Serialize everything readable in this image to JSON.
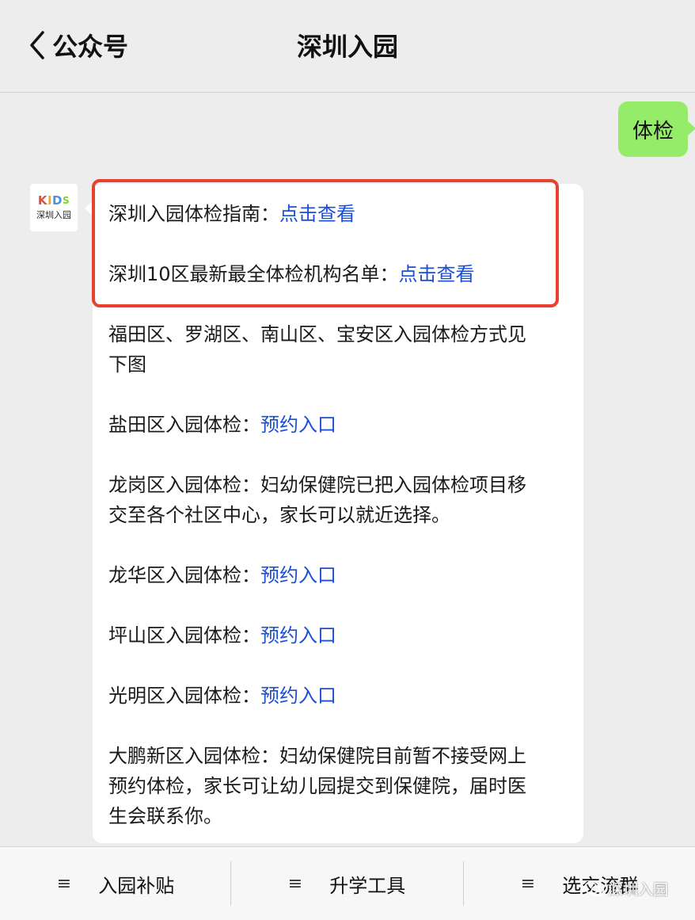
{
  "header": {
    "back_label": "公众号",
    "title": "深圳入园"
  },
  "user_message": "体检",
  "avatar": {
    "logo": "KIDS",
    "name": "深圳入园"
  },
  "bot_message": {
    "lines": [
      {
        "text": "深圳入园体检指南：",
        "link": "点击查看"
      },
      {
        "text": "深圳10区最新最全体检机构名单：",
        "link": "点击查看"
      },
      {
        "text": "福田区、罗湖区、南山区、宝安区入园体检方式见",
        "link": ""
      },
      {
        "text": "下图",
        "link": ""
      },
      {
        "text": "盐田区入园体检：",
        "link": "预约入口"
      },
      {
        "text": "龙岗区入园体检：妇幼保健院已把入园体检项目移",
        "link": ""
      },
      {
        "text": "交至各个社区中心，家长可以就近选择。",
        "link": ""
      },
      {
        "text": "龙华区入园体检：",
        "link": "预约入口"
      },
      {
        "text": "坪山区入园体检：",
        "link": "预约入口"
      },
      {
        "text": "光明区入园体检：",
        "link": "预约入口"
      },
      {
        "text": "大鹏新区入园体检：妇幼保健院目前暂不接受网上",
        "link": ""
      },
      {
        "text": "预约体检，家长可让幼儿园提交到保健院，届时医",
        "link": ""
      },
      {
        "text": "生会联系你。",
        "link": ""
      }
    ]
  },
  "menu": {
    "items": [
      {
        "label": "入园补贴"
      },
      {
        "label": "升学工具"
      },
      {
        "label": "选交流群"
      }
    ]
  },
  "watermark": "深圳入园",
  "colors": {
    "link": "#1a4ed6",
    "highlight_border": "#e8412e",
    "user_bubble": "#95ec69",
    "background": "#ededed"
  }
}
